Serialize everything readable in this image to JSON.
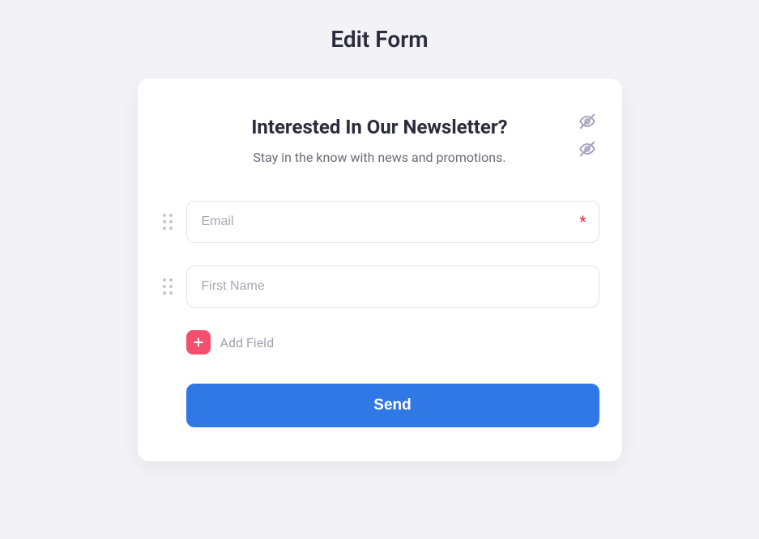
{
  "page_title": "Edit Form",
  "colors": {
    "accent_button": "#2f78e6",
    "add_badge": "#f3506f",
    "required_star": "#e8394d",
    "muted_icon": "#a7a4c1"
  },
  "form": {
    "title": "Interested In Our Newsletter?",
    "subtitle": "Stay in the know with news and promotions.",
    "fields": [
      {
        "placeholder": "Email",
        "required": true
      },
      {
        "placeholder": "First Name",
        "required": false
      }
    ],
    "add_field_label": "Add Field",
    "submit_label": "Send"
  }
}
